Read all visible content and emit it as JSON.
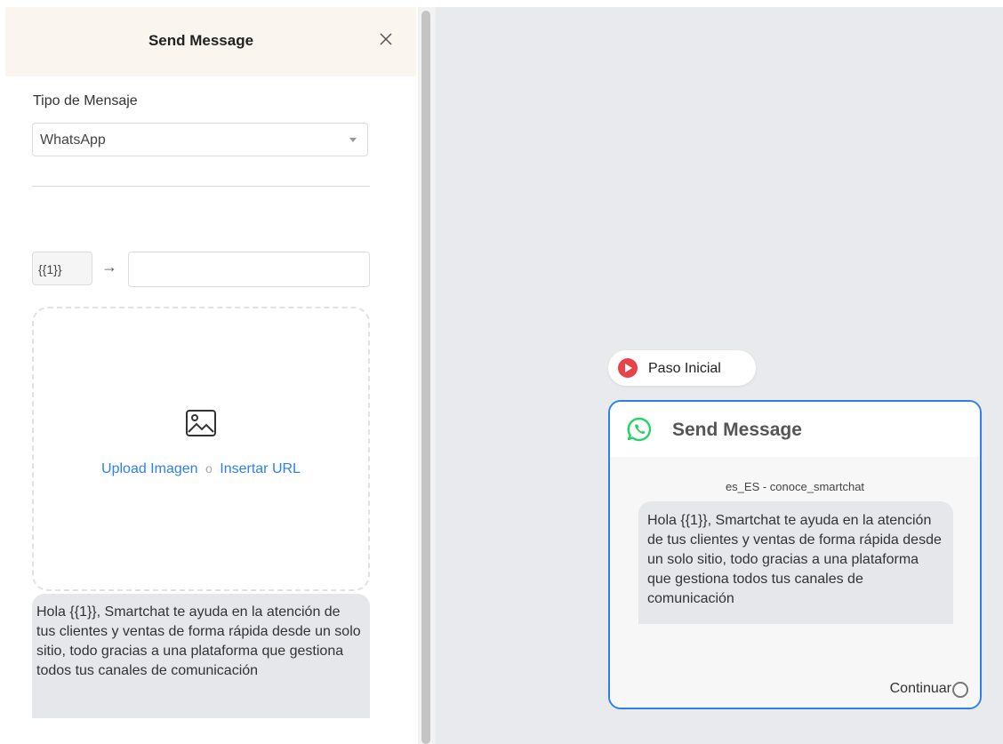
{
  "panel": {
    "title": "Send Message",
    "message_type_label": "Tipo de Mensaje",
    "message_type_value": "WhatsApp",
    "variable_tag": "{{1}}",
    "variable_arrow": "→",
    "variable_value": "",
    "upload_link": "Upload Imagen",
    "or_text": "o",
    "url_link": "Insertar URL",
    "preview_text": "Hola {{1}}, Smartchat te ayuda en la atención de tus clientes y ventas de forma rápida desde un solo sitio, todo gracias a una plataforma que gestiona todos tus canales de comunicación"
  },
  "canvas": {
    "start_label": "Paso Inicial",
    "node_title": "Send Message",
    "template_name": "es_ES - conoce_smartchat",
    "node_text": "Hola {{1}}, Smartchat te ayuda en la atención de tus clientes y ventas de forma rápida desde un solo sitio, todo gracias a una plataforma que gestiona todos tus canales de comunicación",
    "continue_label": "Continuar"
  },
  "colors": {
    "accent": "#2f80ed",
    "start_red": "#e8434b",
    "whatsapp_green": "#25d366",
    "header_bg": "#faf5ef"
  },
  "icons": [
    "close-icon",
    "chevron-down-icon",
    "image-icon",
    "play-icon",
    "whatsapp-icon"
  ]
}
